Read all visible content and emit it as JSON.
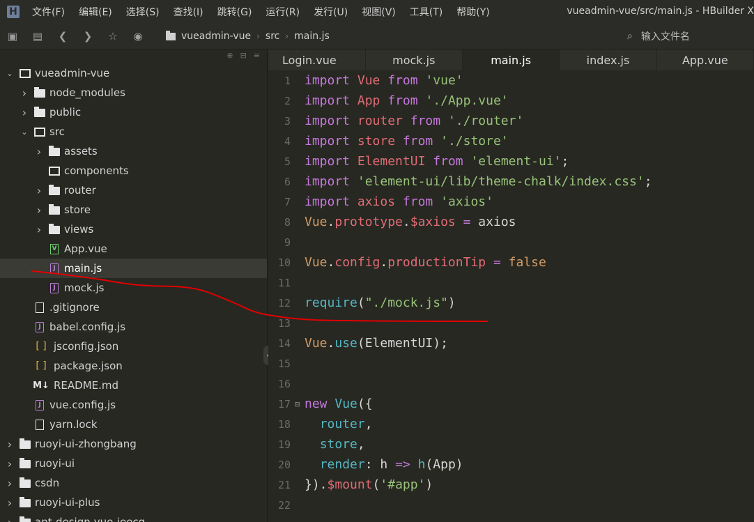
{
  "app": {
    "logo": "H",
    "window_title": "vueadmin-vue/src/main.js - HBuilder X"
  },
  "menu": [
    "文件(F)",
    "编辑(E)",
    "选择(S)",
    "查找(I)",
    "跳转(G)",
    "运行(R)",
    "发行(U)",
    "视图(V)",
    "工具(T)",
    "帮助(Y)"
  ],
  "toolbar": {
    "breadcrumb": [
      "vueadmin-vue",
      "src",
      "main.js"
    ],
    "search_placeholder": "输入文件名"
  },
  "tree": [
    {
      "label": "vueadmin-vue",
      "depth": 0,
      "chevron": "down",
      "icon": "folder-open-icon"
    },
    {
      "label": "node_modules",
      "depth": 1,
      "chevron": "right",
      "icon": "folder-icon"
    },
    {
      "label": "public",
      "depth": 1,
      "chevron": "right",
      "icon": "folder-icon"
    },
    {
      "label": "src",
      "depth": 1,
      "chevron": "down",
      "icon": "folder-open-icon"
    },
    {
      "label": "assets",
      "depth": 2,
      "chevron": "right",
      "icon": "folder-icon"
    },
    {
      "label": "components",
      "depth": 2,
      "chevron": "none",
      "icon": "folder-open-icon"
    },
    {
      "label": "router",
      "depth": 2,
      "chevron": "right",
      "icon": "folder-icon"
    },
    {
      "label": "store",
      "depth": 2,
      "chevron": "right",
      "icon": "folder-icon"
    },
    {
      "label": "views",
      "depth": 2,
      "chevron": "right",
      "icon": "folder-icon"
    },
    {
      "label": "App.vue",
      "depth": 2,
      "chevron": "none",
      "icon": "vue-file-icon"
    },
    {
      "label": "main.js",
      "depth": 2,
      "chevron": "none",
      "icon": "js-file-icon",
      "selected": true
    },
    {
      "label": "mock.js",
      "depth": 2,
      "chevron": "none",
      "icon": "js-file-icon"
    },
    {
      "label": ".gitignore",
      "depth": 1,
      "chevron": "none",
      "icon": "file-icon"
    },
    {
      "label": "babel.config.js",
      "depth": 1,
      "chevron": "none",
      "icon": "js-file-icon"
    },
    {
      "label": "jsconfig.json",
      "depth": 1,
      "chevron": "none",
      "icon": "json-file-icon"
    },
    {
      "label": "package.json",
      "depth": 1,
      "chevron": "none",
      "icon": "json-file-icon"
    },
    {
      "label": "README.md",
      "depth": 1,
      "chevron": "none",
      "icon": "markdown-file-icon"
    },
    {
      "label": "vue.config.js",
      "depth": 1,
      "chevron": "none",
      "icon": "js-file-icon"
    },
    {
      "label": "yarn.lock",
      "depth": 1,
      "chevron": "none",
      "icon": "file-icon"
    },
    {
      "label": "ruoyi-ui-zhongbang",
      "depth": 0,
      "chevron": "right",
      "icon": "folder-icon"
    },
    {
      "label": "ruoyi-ui",
      "depth": 0,
      "chevron": "right",
      "icon": "folder-icon"
    },
    {
      "label": "csdn",
      "depth": 0,
      "chevron": "right",
      "icon": "folder-icon"
    },
    {
      "label": "ruoyi-ui-plus",
      "depth": 0,
      "chevron": "right",
      "icon": "folder-icon"
    },
    {
      "label": "ant-design-vue-jeecg",
      "depth": 0,
      "chevron": "right",
      "icon": "folder-icon"
    }
  ],
  "tabs": [
    {
      "label": "Login.vue",
      "active": false
    },
    {
      "label": "mock.js",
      "active": false
    },
    {
      "label": "main.js",
      "active": true
    },
    {
      "label": "index.js",
      "active": false
    },
    {
      "label": "App.vue",
      "active": false
    }
  ],
  "code": [
    {
      "n": "1",
      "tokens": [
        [
          "kw",
          "import"
        ],
        [
          "plain",
          " "
        ],
        [
          "id",
          "Vue"
        ],
        [
          "plain",
          " "
        ],
        [
          "kw",
          "from"
        ],
        [
          "plain",
          " "
        ],
        [
          "str",
          "'vue'"
        ]
      ]
    },
    {
      "n": "2",
      "tokens": [
        [
          "kw",
          "import"
        ],
        [
          "plain",
          " "
        ],
        [
          "id",
          "App"
        ],
        [
          "plain",
          " "
        ],
        [
          "kw",
          "from"
        ],
        [
          "plain",
          " "
        ],
        [
          "str",
          "'./App.vue'"
        ]
      ]
    },
    {
      "n": "3",
      "tokens": [
        [
          "kw",
          "import"
        ],
        [
          "plain",
          " "
        ],
        [
          "id",
          "router"
        ],
        [
          "plain",
          " "
        ],
        [
          "kw",
          "from"
        ],
        [
          "plain",
          " "
        ],
        [
          "str",
          "'./router'"
        ]
      ]
    },
    {
      "n": "4",
      "tokens": [
        [
          "kw",
          "import"
        ],
        [
          "plain",
          " "
        ],
        [
          "id",
          "store"
        ],
        [
          "plain",
          " "
        ],
        [
          "kw",
          "from"
        ],
        [
          "plain",
          " "
        ],
        [
          "str",
          "'./store'"
        ]
      ]
    },
    {
      "n": "5",
      "tokens": [
        [
          "kw",
          "import"
        ],
        [
          "plain",
          " "
        ],
        [
          "id",
          "ElementUI"
        ],
        [
          "plain",
          " "
        ],
        [
          "kw",
          "from"
        ],
        [
          "plain",
          " "
        ],
        [
          "str",
          "'element-ui'"
        ],
        [
          "plain",
          ";"
        ]
      ]
    },
    {
      "n": "6",
      "tokens": [
        [
          "kw",
          "import"
        ],
        [
          "plain",
          " "
        ],
        [
          "str",
          "'element-ui/lib/theme-chalk/index.css'"
        ],
        [
          "plain",
          ";"
        ]
      ]
    },
    {
      "n": "7",
      "tokens": [
        [
          "kw",
          "import"
        ],
        [
          "plain",
          " "
        ],
        [
          "id",
          "axios"
        ],
        [
          "plain",
          " "
        ],
        [
          "kw",
          "from"
        ],
        [
          "plain",
          " "
        ],
        [
          "str",
          "'axios'"
        ]
      ]
    },
    {
      "n": "8",
      "tokens": [
        [
          "bool",
          "Vue"
        ],
        [
          "plain",
          "."
        ],
        [
          "id",
          "prototype"
        ],
        [
          "plain",
          "."
        ],
        [
          "id",
          "$axios"
        ],
        [
          "plain",
          " "
        ],
        [
          "kw",
          "="
        ],
        [
          "plain",
          " axios"
        ]
      ]
    },
    {
      "n": "9",
      "tokens": []
    },
    {
      "n": "10",
      "tokens": [
        [
          "bool",
          "Vue"
        ],
        [
          "plain",
          "."
        ],
        [
          "id",
          "config"
        ],
        [
          "plain",
          "."
        ],
        [
          "id",
          "productionTip"
        ],
        [
          "plain",
          " "
        ],
        [
          "kw",
          "="
        ],
        [
          "plain",
          " "
        ],
        [
          "bool",
          "false"
        ]
      ]
    },
    {
      "n": "11",
      "tokens": []
    },
    {
      "n": "12",
      "tokens": [
        [
          "fn",
          "require"
        ],
        [
          "plain",
          "("
        ],
        [
          "str",
          "\"./mock.js\""
        ],
        [
          "plain",
          ")"
        ]
      ]
    },
    {
      "n": "13",
      "tokens": []
    },
    {
      "n": "14",
      "tokens": [
        [
          "bool",
          "Vue"
        ],
        [
          "plain",
          "."
        ],
        [
          "fn",
          "use"
        ],
        [
          "plain",
          "(ElementUI);"
        ]
      ]
    },
    {
      "n": "15",
      "tokens": []
    },
    {
      "n": "16",
      "tokens": []
    },
    {
      "n": "17",
      "fold": true,
      "tokens": [
        [
          "kw",
          "new"
        ],
        [
          "plain",
          " "
        ],
        [
          "fn",
          "Vue"
        ],
        [
          "plain",
          "({"
        ]
      ]
    },
    {
      "n": "18",
      "tokens": [
        [
          "plain",
          "  "
        ],
        [
          "fn",
          "router"
        ],
        [
          "plain",
          ","
        ]
      ]
    },
    {
      "n": "19",
      "tokens": [
        [
          "plain",
          "  "
        ],
        [
          "fn",
          "store"
        ],
        [
          "plain",
          ","
        ]
      ]
    },
    {
      "n": "20",
      "tokens": [
        [
          "plain",
          "  "
        ],
        [
          "fn",
          "render"
        ],
        [
          "plain",
          ": h "
        ],
        [
          "kw",
          "=>"
        ],
        [
          "plain",
          " "
        ],
        [
          "fn",
          "h"
        ],
        [
          "plain",
          "(App)"
        ]
      ]
    },
    {
      "n": "21",
      "tokens": [
        [
          "plain",
          "})."
        ],
        [
          "id",
          "$mount"
        ],
        [
          "plain",
          "("
        ],
        [
          "str",
          "'#app'"
        ],
        [
          "plain",
          ")"
        ]
      ]
    },
    {
      "n": "22",
      "tokens": []
    }
  ],
  "colors": {
    "keyword": "#c678dd",
    "identifier": "#e06c75",
    "string": "#98c379",
    "function": "#56b6c2",
    "annotation": "#e00000"
  }
}
